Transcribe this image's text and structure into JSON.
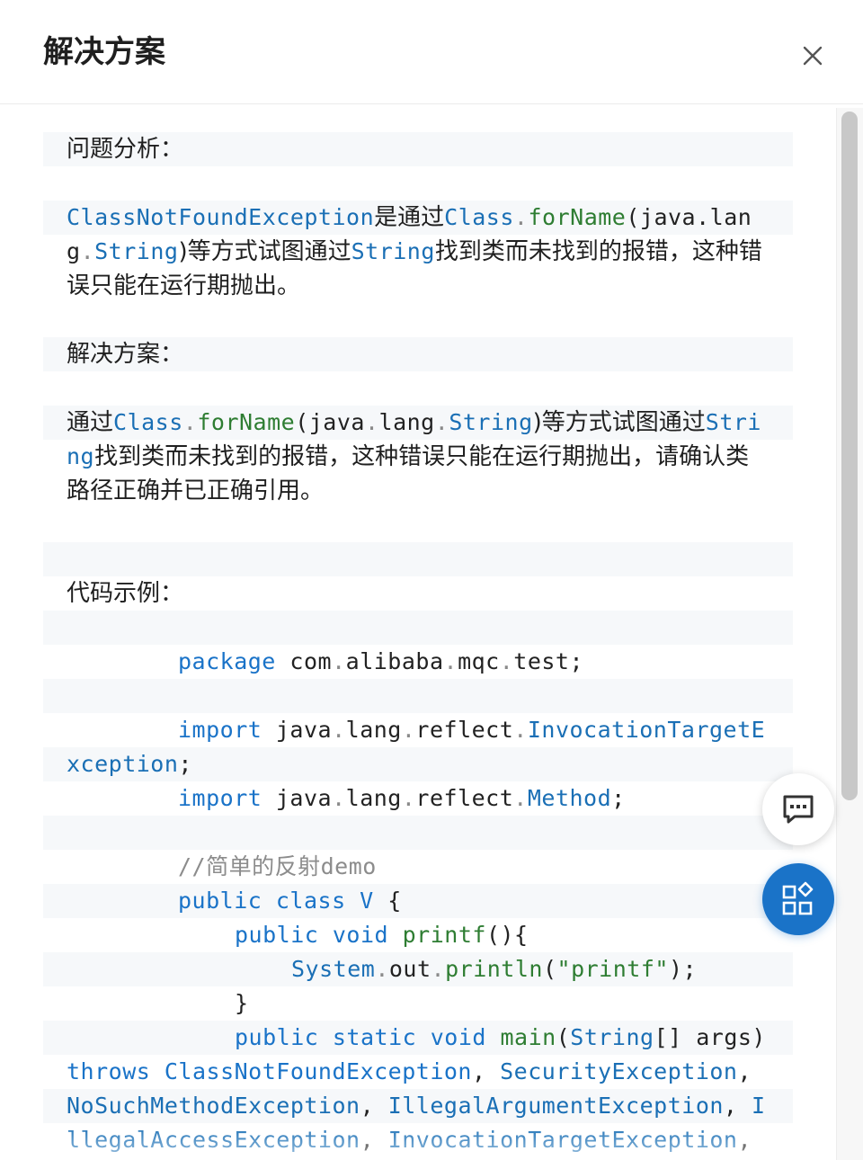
{
  "header": {
    "title": "解决方案"
  },
  "icons": {
    "close": "close-icon",
    "comment": "comment-icon",
    "apps": "apps-icon"
  },
  "colors": {
    "keyword_blue": "#1a73c8",
    "function_green": "#2e7d32",
    "fab_primary": "#1a73c8"
  },
  "content": {
    "analysis_heading": "问题分析：",
    "analysis_line_1": {
      "p1": "ClassNotFoundException",
      "p2": "是通过",
      "p3": "Class",
      "p4": ".",
      "p5": "forName",
      "p6": "(java.lan"
    },
    "analysis_line_2": {
      "p1": "g",
      "p2": ".",
      "p3": "String",
      "p4": ")等方式试图通过",
      "p5": "String",
      "p6": "找到类而未找到的报错，这种错"
    },
    "analysis_line_3": "误只能在运行期抛出。",
    "solution_heading": "解决方案：",
    "solution_line_1": {
      "p1": "通过",
      "p2": "Class",
      "p3": ".",
      "p4": "forName",
      "p5": "(java",
      "p6": ".",
      "p7": "lang",
      "p8": ".",
      "p9": "String",
      "p10": ")等方式试图通过",
      "p11": "Stri"
    },
    "solution_line_2": {
      "p1": "ng",
      "p2": "找到类而未找到的报错，这种错误只能在运行期抛出，请确认类"
    },
    "solution_line_3": "路径正确并已正确引用。",
    "example_heading": "代码示例："
  },
  "code": {
    "l1": {
      "kw": "package",
      "a": " com",
      "d1": ".",
      "b": "alibaba",
      "d2": ".",
      "c": "mqc",
      "d3": ".",
      "e": "test;"
    },
    "l2": {
      "kw": "import",
      "a": " java",
      "d1": ".",
      "b": "lang",
      "d2": ".",
      "c": "reflect",
      "d3": ".",
      "e": "InvocationTargetE"
    },
    "l3": {
      "a": "xception",
      "b": ";"
    },
    "l4": {
      "kw": "import",
      "a": " java",
      "d1": ".",
      "b": "lang",
      "d2": ".",
      "c": "reflect",
      "d3": ".",
      "e": "Method",
      "f": ";"
    },
    "l5": "//简单的反射demo",
    "l6": {
      "kw": "public class V",
      "b": " {"
    },
    "l7": {
      "kw": "public void",
      "fn": " printf",
      "b": "(){"
    },
    "l8": {
      "a": "System",
      "d1": ".",
      "b": "out",
      "d2": ".",
      "fn": "println",
      "c": "(",
      "st": "\"printf\"",
      "e": ");"
    },
    "l9": "}",
    "l10": {
      "kw": "public static void",
      "fn": " main",
      "b": "(",
      "tp": "String",
      "c": "[] args)"
    },
    "l11": {
      "a": "throws ClassNotFoundException",
      "b": ", ",
      "c": "SecurityException",
      "d": ","
    },
    "l12": {
      "a": "NoSuchMethodException",
      "b": ", ",
      "c": "IllegalArgumentException",
      "d": ", ",
      "e": "I"
    },
    "l13": {
      "a": "llegalAccessException",
      "b": ", ",
      "c": "InvocationTargetException",
      "d": ","
    }
  }
}
